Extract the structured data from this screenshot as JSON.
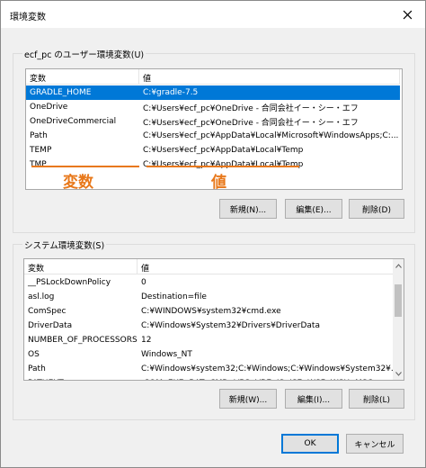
{
  "window": {
    "title": "環境変数",
    "close_glyph": "✕"
  },
  "user_vars": {
    "group_title": "ecf_pc のユーザー環境変数(U)",
    "columns": {
      "variable": "変数",
      "value": "値"
    },
    "rows": [
      {
        "variable": "GRADLE_HOME",
        "value": "C:¥gradle-7.5",
        "selected": true
      },
      {
        "variable": "OneDrive",
        "value": "C:¥Users¥ecf_pc¥OneDrive - 合同会社イー・シー・エフ"
      },
      {
        "variable": "OneDriveCommercial",
        "value": "C:¥Users¥ecf_pc¥OneDrive - 合同会社イー・シー・エフ"
      },
      {
        "variable": "Path",
        "value": "C:¥Users¥ecf_pc¥AppData¥Local¥Microsoft¥WindowsApps;C:..."
      },
      {
        "variable": "TEMP",
        "value": "C:¥Users¥ecf_pc¥AppData¥Local¥Temp"
      },
      {
        "variable": "TMP",
        "value": "C:¥Users¥ecf_pc¥AppData¥Local¥Temp"
      }
    ],
    "annotation_variable": "変数",
    "annotation_value": "値",
    "annotation_color": "#e8781a",
    "buttons": {
      "new": "新規(N)...",
      "edit": "編集(E)...",
      "delete": "削除(D)"
    }
  },
  "system_vars": {
    "group_title": "システム環境変数(S)",
    "columns": {
      "variable": "変数",
      "value": "値"
    },
    "rows": [
      {
        "variable": "__PSLockDownPolicy",
        "value": "0"
      },
      {
        "variable": "asl.log",
        "value": "Destination=file"
      },
      {
        "variable": "ComSpec",
        "value": "C:¥WINDOWS¥system32¥cmd.exe"
      },
      {
        "variable": "DriverData",
        "value": "C:¥Windows¥System32¥Drivers¥DriverData"
      },
      {
        "variable": "NUMBER_OF_PROCESSORS",
        "value": "12"
      },
      {
        "variable": "OS",
        "value": "Windows_NT"
      },
      {
        "variable": "Path",
        "value": "C:¥Windows¥system32;C:¥Windows;C:¥Windows¥System32¥..."
      },
      {
        "variable": "PATHEXT",
        "value": ".COM;.EXE;.BAT;.CMD;.VBS;.VBE;.JS;.JSE;.WSF;.WSH;.MSC"
      }
    ],
    "buttons": {
      "new": "新規(W)...",
      "edit": "編集(I)...",
      "delete": "削除(L)"
    }
  },
  "footer": {
    "ok": "OK",
    "cancel": "キャンセル"
  },
  "colors": {
    "selection": "#0078d7",
    "annotation": "#e8781a"
  }
}
